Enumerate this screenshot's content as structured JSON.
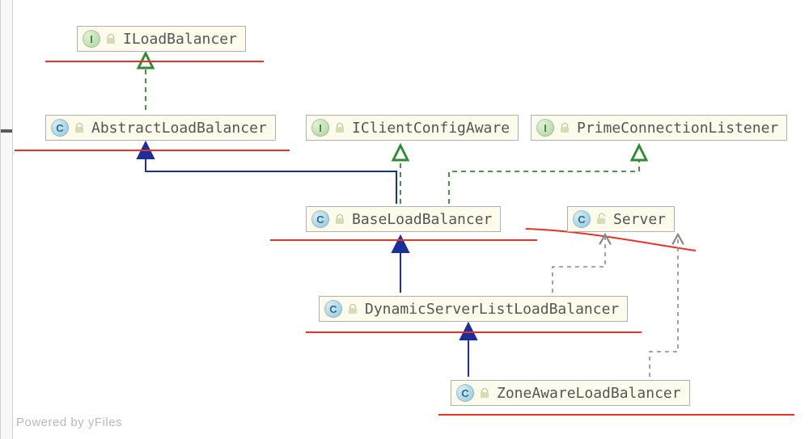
{
  "credit": "Powered by yFiles",
  "nodes": {
    "iload": {
      "kind": "I",
      "label": "ILoadBalancer"
    },
    "abstract": {
      "kind": "C",
      "label": "AbstractLoadBalancer"
    },
    "iclient": {
      "kind": "I",
      "label": "IClientConfigAware"
    },
    "prime": {
      "kind": "I",
      "label": "PrimeConnectionListener"
    },
    "base": {
      "kind": "C",
      "label": "BaseLoadBalancer"
    },
    "server": {
      "kind": "C",
      "label": "Server"
    },
    "dynamic": {
      "kind": "C",
      "label": "DynamicServerListLoadBalancer"
    },
    "zone": {
      "kind": "C",
      "label": "ZoneAwareLoadBalancer"
    }
  },
  "edges": [
    {
      "from": "abstract",
      "to": "iload",
      "style": "implements"
    },
    {
      "from": "base",
      "to": "abstract",
      "style": "extends"
    },
    {
      "from": "base",
      "to": "iclient",
      "style": "implements"
    },
    {
      "from": "base",
      "to": "prime",
      "style": "implements"
    },
    {
      "from": "dynamic",
      "to": "base",
      "style": "extends"
    },
    {
      "from": "dynamic",
      "to": "server",
      "style": "uses"
    },
    {
      "from": "zone",
      "to": "dynamic",
      "style": "extends"
    },
    {
      "from": "zone",
      "to": "server",
      "style": "uses"
    }
  ],
  "legend": {
    "implements": "dashed green arrow, hollow triangle head",
    "extends": "solid blue arrow, filled triangle head",
    "uses": "dashed grey arrow, open head"
  }
}
